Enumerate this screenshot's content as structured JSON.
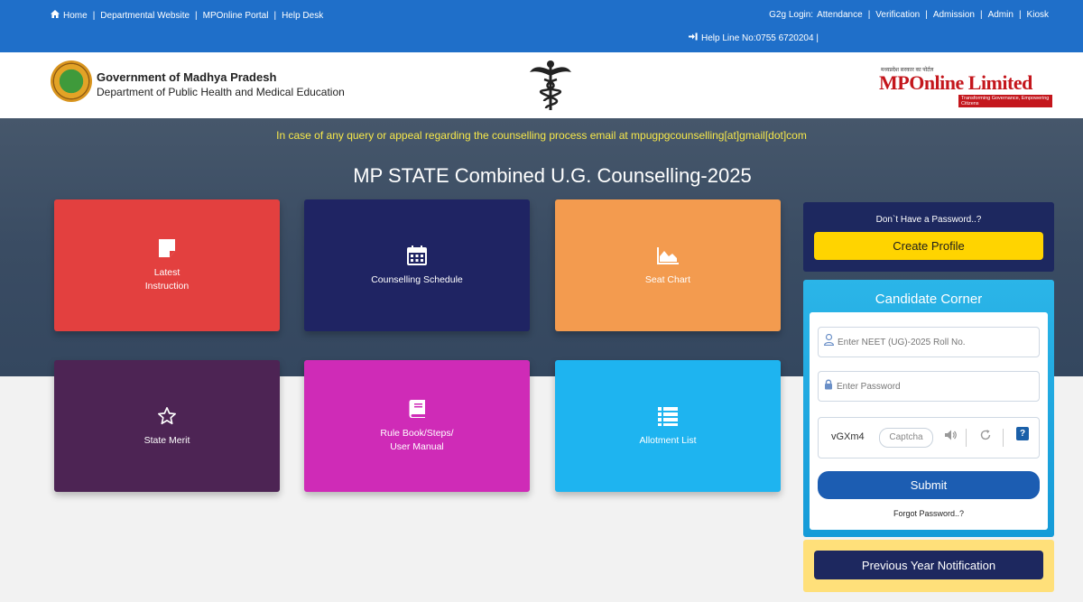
{
  "topbar": {
    "links_left": [
      "Home",
      "Departmental Website",
      "MPOnline Portal",
      "Help Desk"
    ],
    "g2g_label": "G2g Login:",
    "links_right": [
      "Attendance",
      "Verification",
      "Admission",
      "Admin",
      "Kiosk"
    ],
    "helpline": "Help Line No:0755 6720204 |"
  },
  "header": {
    "gov_line1": "Government of Madhya Pradesh",
    "gov_line2": "Department of Public Health and Medical Education",
    "mp_small": "मध्यप्रदेश सरकार का पोर्टल",
    "mp_name": "MPOnline Limited",
    "mp_tagline": "Transforming Governance, Empowering Citizens"
  },
  "notice": "In case of any query or appeal regarding the counselling process email at mpugpgcounselling[at]gmail[dot]com",
  "hero_title": "MP STATE Combined U.G. Counselling-2025",
  "tiles": [
    {
      "label": "Latest\nInstruction",
      "color": "#e3403f",
      "icon": "note-icon"
    },
    {
      "label": "Counselling Schedule",
      "color": "#1f2463",
      "icon": "calendar-icon"
    },
    {
      "label": "Seat Chart",
      "color": "#f39b4f",
      "icon": "area-chart-icon"
    },
    {
      "label": "State Merit",
      "color": "#4d2454",
      "icon": "star-icon"
    },
    {
      "label": "Rule Book/Steps/\nUser Manual",
      "color": "#cf2bb7",
      "icon": "book-icon"
    },
    {
      "label": "Allotment List",
      "color": "#1eb4f0",
      "icon": "list-icon"
    }
  ],
  "password_box": {
    "question": "Don`t Have a Password..?",
    "create_label": "Create Profile"
  },
  "candidate_corner": {
    "title": "Candidate Corner",
    "roll_placeholder": "Enter NEET (UG)-2025 Roll No.",
    "password_placeholder": "Enter Password",
    "captcha_code": "vGXm4",
    "captcha_placeholder": "Captcha",
    "help_label": "?",
    "submit_label": "Submit",
    "forgot_label": "Forgot Password..?"
  },
  "previous_label": "Previous Year Notification"
}
